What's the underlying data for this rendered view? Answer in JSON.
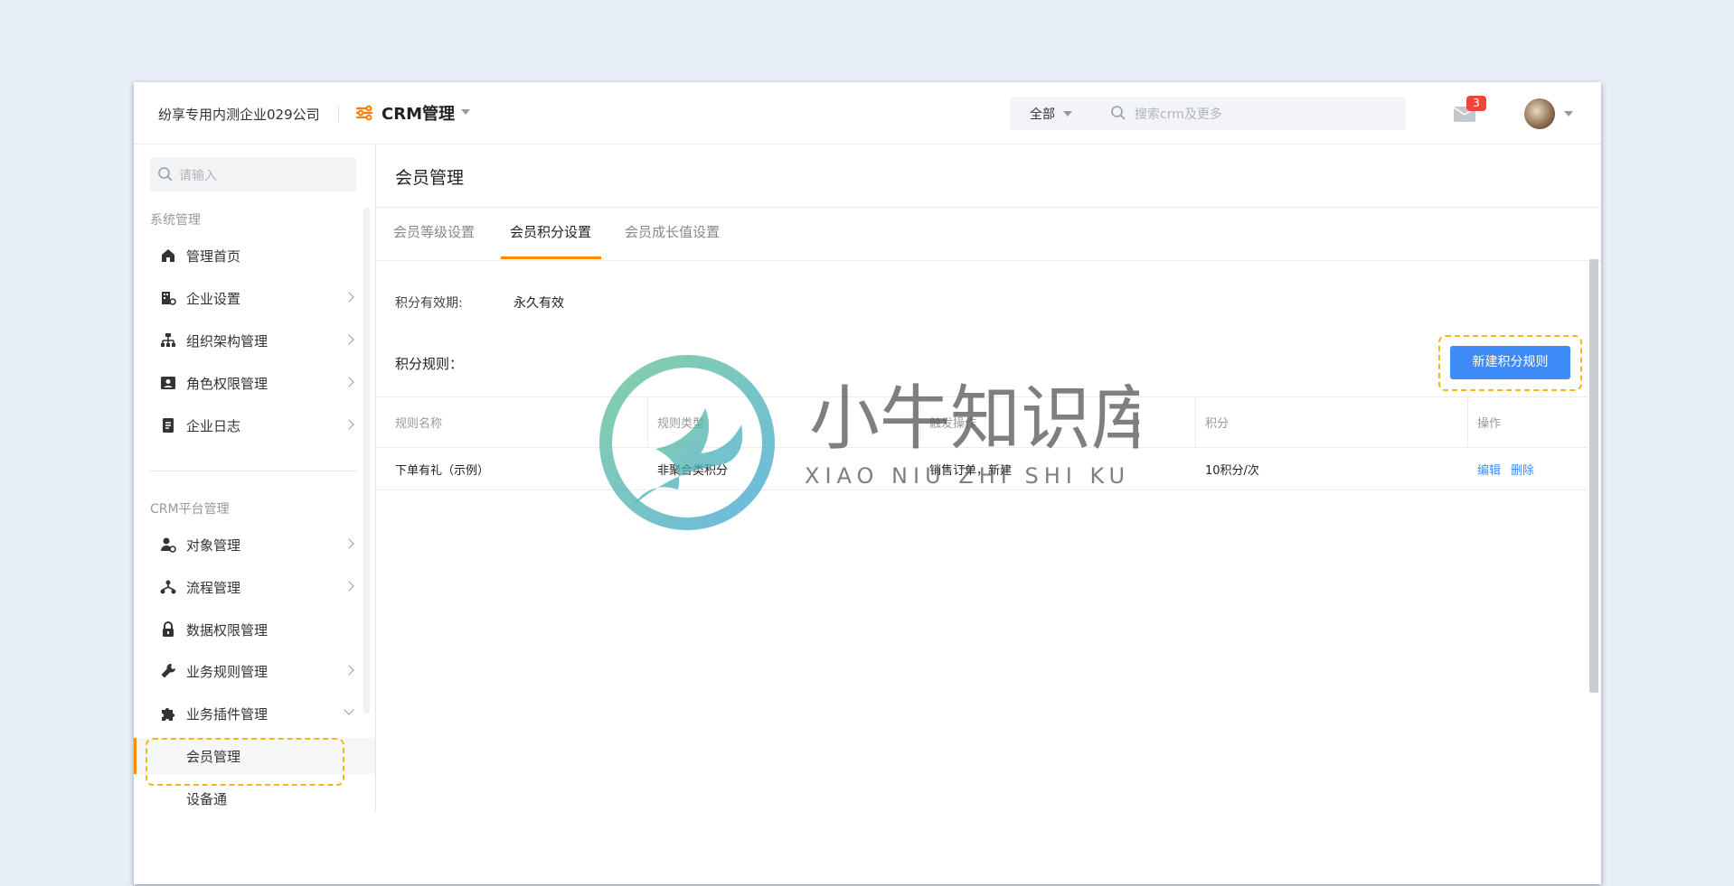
{
  "topbar": {
    "company": "纷享专用内测企业029公司",
    "app_title": "CRM管理",
    "search_scope": "全部",
    "search_placeholder": "搜索crm及更多",
    "notification_count": "3"
  },
  "sidebar": {
    "search_placeholder": "请输入",
    "section_system": "系统管理",
    "system_items": [
      {
        "label": "管理首页",
        "icon": "home-icon"
      },
      {
        "label": "企业设置",
        "icon": "building-settings-icon"
      },
      {
        "label": "组织架构管理",
        "icon": "org-chart-icon"
      },
      {
        "label": "角色权限管理",
        "icon": "id-card-icon"
      },
      {
        "label": "企业日志",
        "icon": "log-document-icon"
      }
    ],
    "section_crm": "CRM平台管理",
    "crm_items": [
      {
        "label": "对象管理",
        "icon": "user-gear-icon"
      },
      {
        "label": "流程管理",
        "icon": "flow-icon"
      },
      {
        "label": "数据权限管理",
        "icon": "lock-icon"
      },
      {
        "label": "业务规则管理",
        "icon": "wrench-icon"
      },
      {
        "label": "业务插件管理",
        "icon": "puzzle-icon"
      }
    ],
    "plugin_subitems": [
      {
        "label": "会员管理"
      },
      {
        "label": "设备通"
      }
    ]
  },
  "main": {
    "page_title": "会员管理",
    "tabs": [
      {
        "label": "会员等级设置"
      },
      {
        "label": "会员积分设置"
      },
      {
        "label": "会员成长值设置"
      }
    ],
    "validity_label": "积分有效期:",
    "validity_value": "永久有效",
    "rules_label": "积分规则：",
    "new_rule_button": "新建积分规则",
    "table": {
      "headers": [
        "规则名称",
        "规则类型",
        "触发操作",
        "积分",
        "操作"
      ],
      "rows": [
        {
          "name": "下单有礼（示例）",
          "type": "非聚合类积分",
          "trigger": "销售订单，新建",
          "points": "10积分/次",
          "edit": "编辑",
          "delete": "删除"
        }
      ]
    }
  },
  "watermark": {
    "text_cn": "小牛知识库",
    "text_en": "XIAO NIU ZHI SHI KU"
  },
  "colors": {
    "accent_orange": "#ff8a00",
    "primary_blue": "#3e8af6",
    "highlight_yellow": "#f2b71b",
    "badge_red": "#f0453a"
  }
}
